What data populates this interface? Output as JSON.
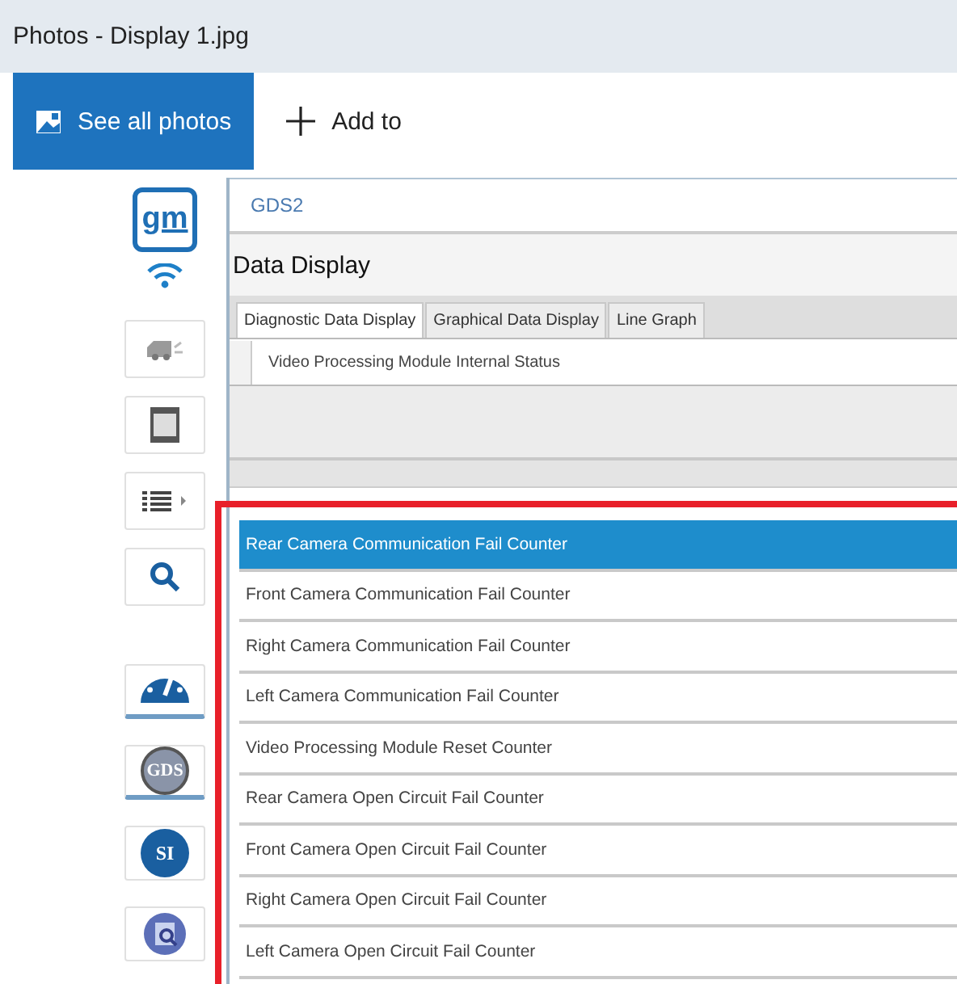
{
  "window": {
    "title": "Photos - Display 1.jpg"
  },
  "toolbar": [
    {
      "kind": "gallery",
      "label": "See all photos",
      "selected": true
    },
    {
      "kind": "add",
      "label": "Add to",
      "selected": false
    }
  ],
  "sidebar": [
    {
      "kind": "logo",
      "label": "gm",
      "selected": false
    },
    {
      "kind": "wifi",
      "selected": false
    },
    {
      "kind": "vehicle",
      "selected": false
    },
    {
      "kind": "screen",
      "selected": false
    },
    {
      "kind": "list",
      "selected": false
    },
    {
      "kind": "search",
      "selected": false
    },
    {
      "kind": "gauge",
      "selected": true
    },
    {
      "kind": "badge",
      "label": "GDS",
      "selected": true
    },
    {
      "kind": "badge",
      "label": "SI",
      "selected": false
    },
    {
      "kind": "report",
      "selected": false
    }
  ],
  "app": {
    "title": "GDS2",
    "heading": "Data Display",
    "tabs": [
      {
        "label": "Diagnostic Data Display",
        "selected": true
      },
      {
        "label": "Graphical Data Display",
        "selected": false
      },
      {
        "label": "Line Graph",
        "selected": false
      }
    ],
    "module": {
      "name": "Video Processing Module Internal Status",
      "checked": false
    },
    "parameters": [
      {
        "name": "Rear Camera Communication Fail Counter",
        "selected": true
      },
      {
        "name": "Front Camera Communication Fail Counter",
        "selected": false
      },
      {
        "name": "Right Camera Communication Fail Counter",
        "selected": false
      },
      {
        "name": "Left Camera Communication Fail Counter",
        "selected": false
      },
      {
        "name": "Video Processing Module Reset Counter",
        "selected": false
      },
      {
        "name": "Rear Camera Open Circuit Fail Counter",
        "selected": false
      },
      {
        "name": "Front Camera Open Circuit Fail Counter",
        "selected": false
      },
      {
        "name": "Right Camera Open Circuit Fail Counter",
        "selected": false
      },
      {
        "name": "Left Camera Open Circuit Fail Counter",
        "selected": false
      }
    ]
  }
}
